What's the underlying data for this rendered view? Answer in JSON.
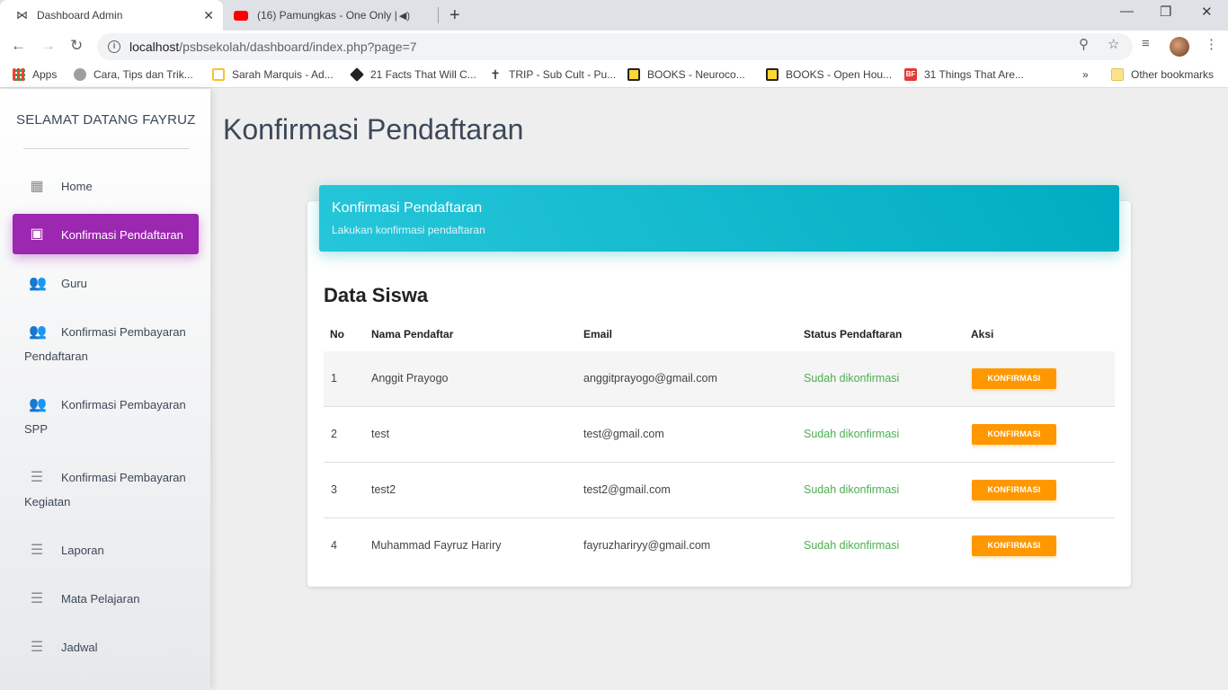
{
  "browser": {
    "tabs": [
      {
        "title": "Dashboard Admin",
        "active": true
      },
      {
        "title": "(16) Pamungkas - One Only |",
        "active": false
      }
    ],
    "url_host": "localhost",
    "url_path": "/psbsekolah/dashboard/index.php?page=7",
    "bookmarks": [
      "Apps",
      "Cara, Tips dan Trik...",
      "Sarah Marquis - Ad...",
      "21 Facts That Will C...",
      "TRIP - Sub Cult - Pu...",
      "BOOKS - Neuroco...",
      "BOOKS - Open Hou...",
      "31 Things That Are...",
      "Other bookmarks"
    ]
  },
  "sidebar": {
    "brand": "SELAMAT DATANG FAYRUZ",
    "items": [
      {
        "line1": "Home",
        "line2": "",
        "icon": "dashboard-icon",
        "active": false
      },
      {
        "line1": "Konfirmasi Pendaftaran",
        "line2": "",
        "icon": "clipboard-icon",
        "active": true
      },
      {
        "line1": "Guru",
        "line2": "",
        "icon": "people-icon",
        "active": false
      },
      {
        "line1": "Konfirmasi Pembayaran",
        "line2": "Pendaftaran",
        "icon": "people-icon",
        "active": false
      },
      {
        "line1": "Konfirmasi Pembayaran",
        "line2": "SPP",
        "icon": "people-icon",
        "active": false
      },
      {
        "line1": "Konfirmasi Pembayaran",
        "line2": "Kegiatan",
        "icon": "lines-icon",
        "active": false
      },
      {
        "line1": "Laporan",
        "line2": "",
        "icon": "lines-icon",
        "active": false
      },
      {
        "line1": "Mata Pelajaran",
        "line2": "",
        "icon": "lines-icon",
        "active": false
      },
      {
        "line1": "Jadwal",
        "line2": "",
        "icon": "lines-icon",
        "active": false
      }
    ]
  },
  "main": {
    "page_title": "Konfirmasi Pendaftaran",
    "card_title": "Konfirmasi Pendaftaran",
    "card_subtitle": "Lakukan konfirmasi pendaftaran",
    "section_title": "Data Siswa",
    "table": {
      "headers": [
        "No",
        "Nama Pendaftar",
        "Email",
        "Status Pendaftaran",
        "Aksi"
      ],
      "rows": [
        {
          "no": "1",
          "nama": "Anggit Prayogo",
          "email": "anggitprayogo@gmail.com",
          "status": "Sudah dikonfirmasi",
          "aksi": "KONFIRMASI"
        },
        {
          "no": "2",
          "nama": "test",
          "email": "test@gmail.com",
          "status": "Sudah dikonfirmasi",
          "aksi": "KONFIRMASI"
        },
        {
          "no": "3",
          "nama": "test2",
          "email": "test2@gmail.com",
          "status": "Sudah dikonfirmasi",
          "aksi": "KONFIRMASI"
        },
        {
          "no": "4",
          "nama": "Muhammad Fayruz Hariry",
          "email": "fayruzhariryy@gmail.com",
          "status": "Sudah dikonfirmasi",
          "aksi": "KONFIRMASI"
        }
      ]
    }
  },
  "colors": {
    "active_nav": "#9c27b0",
    "header_gradient": [
      "#26c6da",
      "#00acc1"
    ],
    "status_green": "#4caf50",
    "button_orange": "#ff9800"
  }
}
